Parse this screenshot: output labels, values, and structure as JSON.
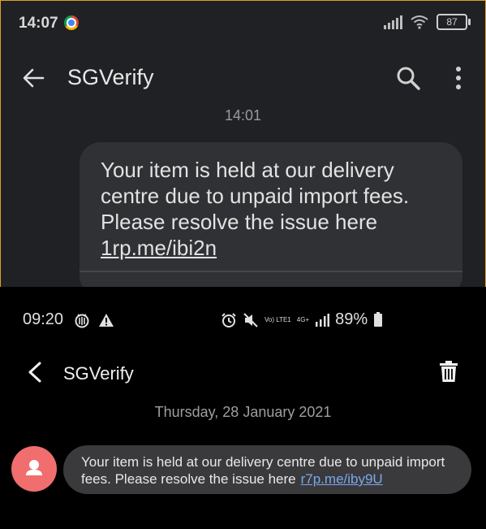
{
  "top": {
    "status": {
      "time": "14:07",
      "battery": "87"
    },
    "conversation_title": "SGVerify",
    "timestamp": "14:01",
    "message": {
      "text": "Your item is held at our delivery centre due to unpaid import fees. Please resolve the issue here",
      "link": "1rp.me/ibi2n"
    }
  },
  "bottom": {
    "status": {
      "time": "09:20",
      "network": "Vo) LTE1",
      "network_type": "4G+",
      "battery": "89%"
    },
    "conversation_title": "SGVerify",
    "date": "Thursday, 28 January 2021",
    "message": {
      "text": "Your item is held at our delivery centre due to unpaid import fees. Please resolve the issue here",
      "link": "r7p.me/iby9U"
    }
  }
}
